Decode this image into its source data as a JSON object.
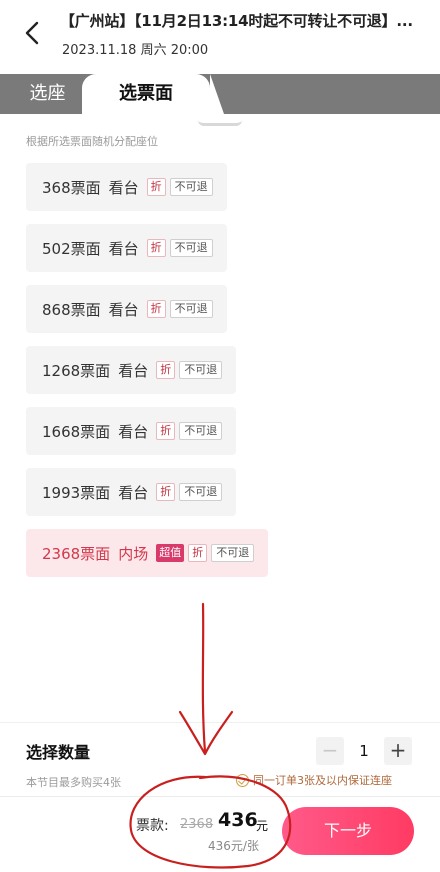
{
  "header": {
    "title": "【广州站】【11月2日13:14时起不可转让不可退】...",
    "subtitle": "2023.11.18 周六 20:00"
  },
  "tabs": {
    "seat": "选座",
    "ticket": "选票面"
  },
  "hint": "根据所选票面随机分配座位",
  "tickets": [
    {
      "price": "368票面",
      "zone": "看台",
      "discount": "折",
      "refund": "不可退"
    },
    {
      "price": "502票面",
      "zone": "看台",
      "discount": "折",
      "refund": "不可退"
    },
    {
      "price": "868票面",
      "zone": "看台",
      "discount": "折",
      "refund": "不可退"
    },
    {
      "price": "1268票面",
      "zone": "看台",
      "discount": "折",
      "refund": "不可退"
    },
    {
      "price": "1668票面",
      "zone": "看台",
      "discount": "折",
      "refund": "不可退"
    },
    {
      "price": "1993票面",
      "zone": "看台",
      "discount": "折",
      "refund": "不可退"
    },
    {
      "price": "2368票面",
      "zone": "内场",
      "hot": "超值",
      "discount": "折",
      "refund": "不可退"
    }
  ],
  "quantity": {
    "label": "选择数量",
    "limit": "本节目最多购买4张",
    "minus": "−",
    "plus": "+",
    "value": "1",
    "guarantee": "同一订单3张及以内保证连座"
  },
  "footer": {
    "pay_label": "票款:",
    "original_price": "2368",
    "price": "436",
    "price_unit": "元",
    "per_ticket": "436元/张",
    "next": "下一步"
  },
  "colors": {
    "accent": "#ff3b63",
    "selected_bg": "#fce8ea",
    "annotation": "#c8201f"
  }
}
